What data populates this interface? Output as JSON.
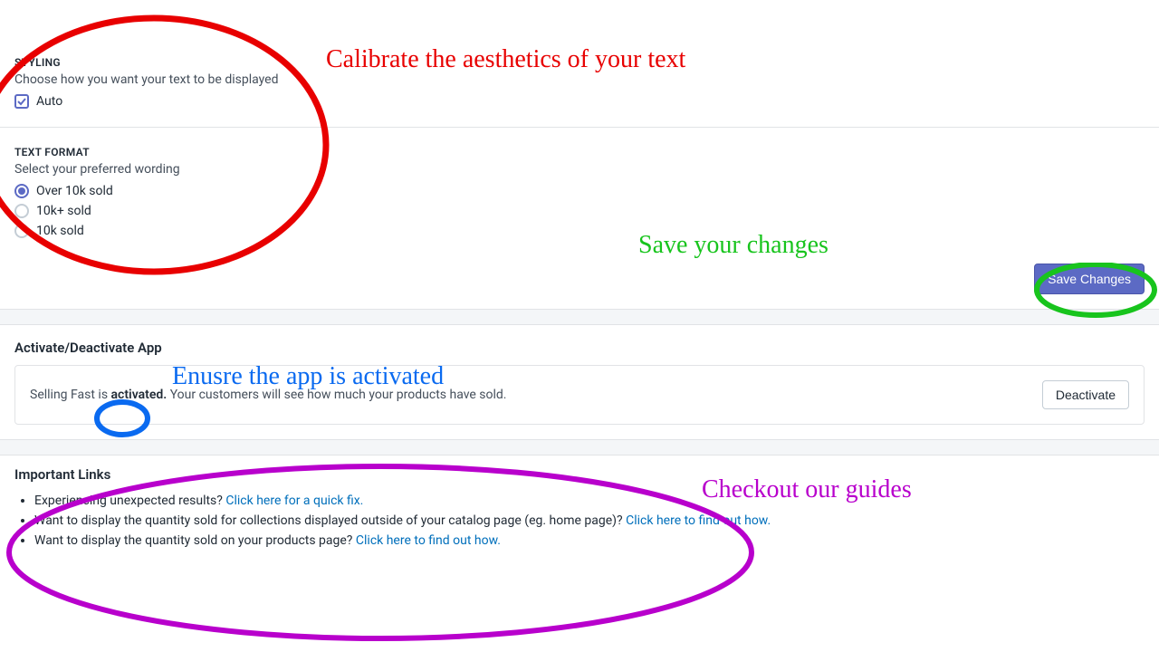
{
  "styling": {
    "heading": "STYLING",
    "sub": "Choose how you want your text to be displayed",
    "auto_label": "Auto",
    "auto_checked": true
  },
  "textformat": {
    "heading": "TEXT FORMAT",
    "sub": "Select your preferred wording",
    "options": [
      {
        "label": "Over 10k sold",
        "checked": true
      },
      {
        "label": "10k+ sold",
        "checked": false
      },
      {
        "label": "10k sold",
        "checked": false
      }
    ]
  },
  "save_button": "Save Changes",
  "activate_section": {
    "heading": "Activate/Deactivate App",
    "text_prefix": "Selling Fast is ",
    "status_word": "activated.",
    "text_suffix": " Your customers will see how much your products have sold.",
    "button": "Deactivate"
  },
  "links_section": {
    "heading": "Important Links",
    "items": [
      {
        "text": "Experiencing unexpected results? ",
        "link": "Click here for a quick fix."
      },
      {
        "text": "Want to display the quantity sold for collections displayed outside of your catalog page (eg. home page)? ",
        "link": "Click here to find out how."
      },
      {
        "text": "Want to display the quantity sold on your products page? ",
        "link": "Click here to find out how."
      }
    ]
  },
  "annotations": {
    "a1": "Calibrate the aesthetics of your text",
    "a2": "Save your changes",
    "a3": "Enusre the app is activated",
    "a4": "Checkout our guides"
  }
}
